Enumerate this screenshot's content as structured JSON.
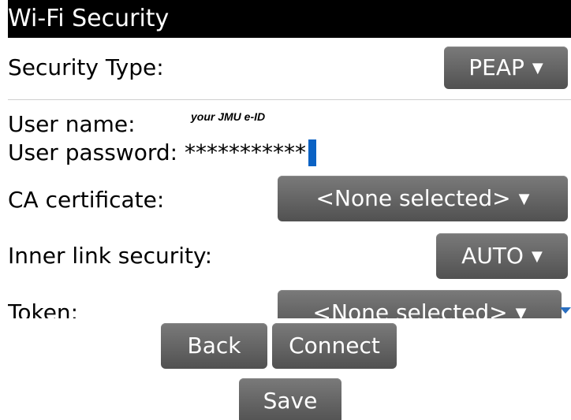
{
  "header": {
    "title": "Wi-Fi Security"
  },
  "security_type": {
    "label": "Security Type:",
    "value": "PEAP"
  },
  "user_name": {
    "label": "User name:",
    "hint": "your JMU e-ID"
  },
  "user_password": {
    "label": "User password:",
    "value": "***********"
  },
  "ca_certificate": {
    "label": "CA certificate:",
    "value": "<None selected>"
  },
  "inner_link_security": {
    "label": "Inner link security:",
    "value": "AUTO"
  },
  "token": {
    "label": "Token:",
    "value": "<None selected>"
  },
  "actions": {
    "back": "Back",
    "connect": "Connect",
    "save": "Save"
  },
  "icons": {
    "dropdown": "chevron-down-icon",
    "scroll": "scroll-down-icon"
  },
  "colors": {
    "button_top": "#7a7a7a",
    "button_bottom": "#515151",
    "cursor": "#0b62c4",
    "header_bg": "#000000"
  }
}
